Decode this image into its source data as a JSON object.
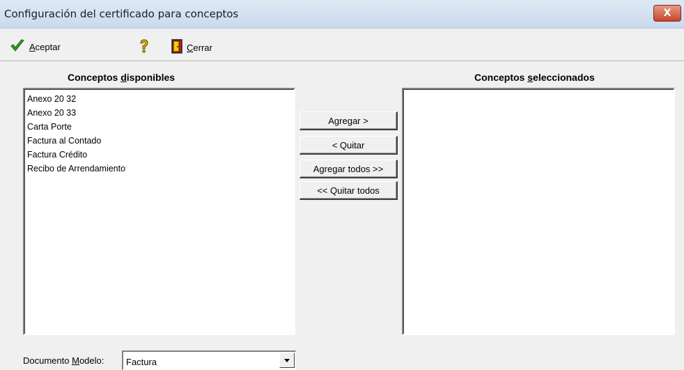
{
  "window": {
    "title": "Configuración del certificado para conceptos",
    "close_label": "X"
  },
  "toolbar": {
    "accept_first": "A",
    "accept_rest": "ceptar",
    "close_first": "C",
    "close_rest": "errar"
  },
  "available": {
    "title_pre": "Conceptos ",
    "title_u": "d",
    "title_post": "isponibles",
    "items": [
      "Anexo 20 32",
      "Anexo 20 33",
      "Carta Porte",
      "Factura al Contado",
      "Factura Crédito",
      "Recibo de Arrendamiento"
    ]
  },
  "selected": {
    "title_pre": "Conceptos ",
    "title_u": "s",
    "title_post": "eleccionados",
    "items": []
  },
  "actions": {
    "add": "Agregar >",
    "remove": "< Quitar",
    "add_all": "Agregar todos >>",
    "remove_all": "<< Quitar todos"
  },
  "footer": {
    "label_pre": "Documento ",
    "label_u": "M",
    "label_post": "odelo:",
    "model_value": "Factura"
  },
  "colors": {
    "accept_check": "#2e9a1e",
    "help_icon": "#e0b000",
    "close_icon": "#e01010"
  }
}
